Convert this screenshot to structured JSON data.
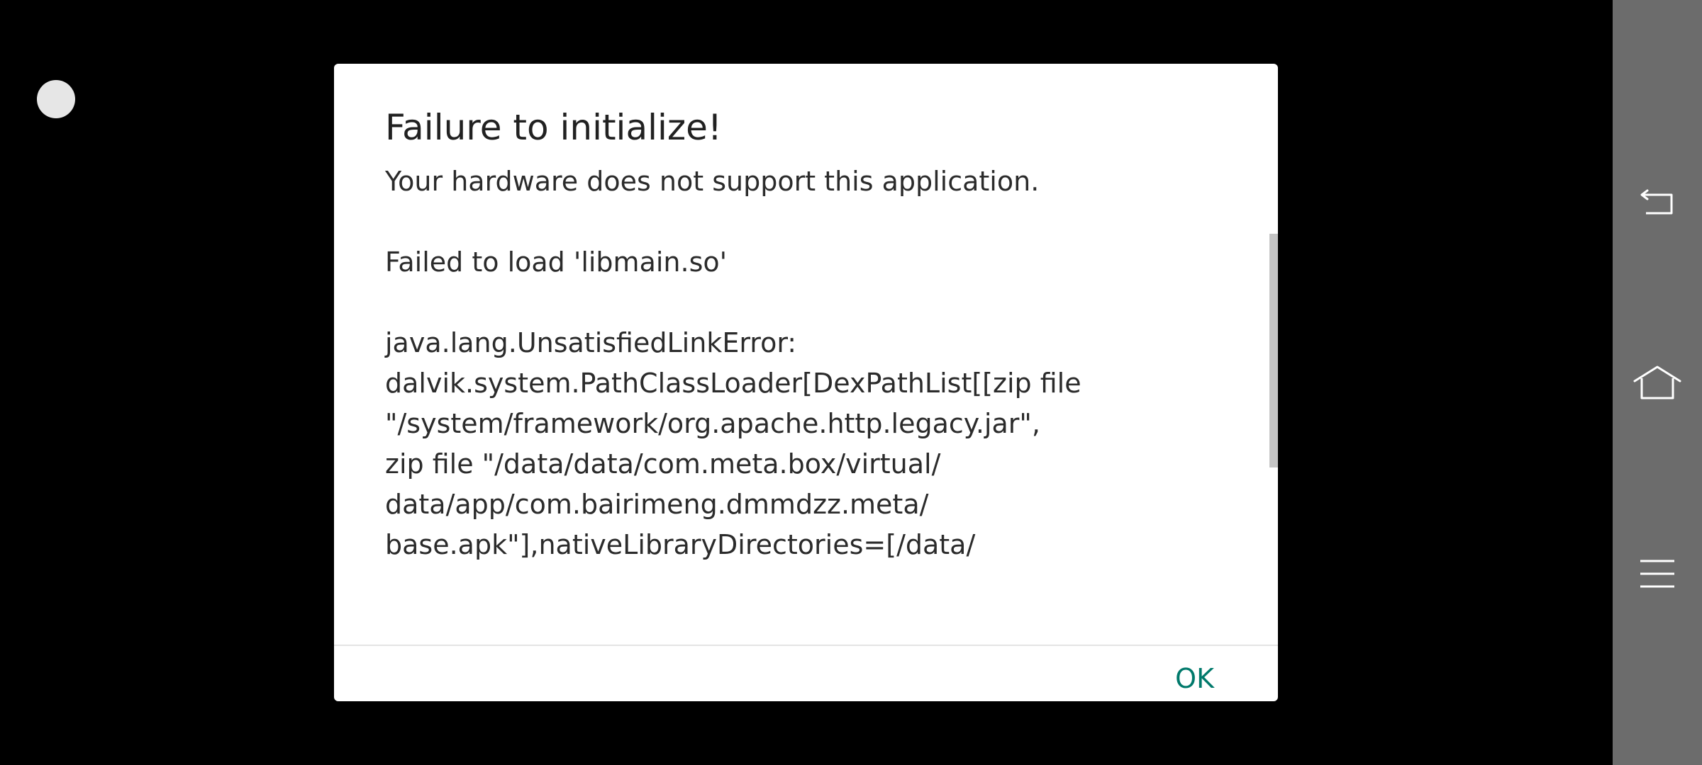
{
  "dialog": {
    "title": "Failure to initialize!",
    "message": "Your hardware does not support this application.\n\nFailed to load 'libmain.so'\n\njava.lang.UnsatisfiedLinkError:\ndalvik.system.PathClassLoader[DexPathList[[zip file\n\"/system/framework/org.apache.http.legacy.jar\",\nzip file \"/data/data/com.meta.box/virtual/\ndata/app/com.bairimeng.dmmdzz.meta/\nbase.apk\"],nativeLibraryDirectories=[/data/",
    "ok_label": "OK"
  },
  "nav_bar": {
    "buttons": [
      {
        "icon": "back-icon"
      },
      {
        "icon": "home-icon"
      },
      {
        "icon": "menu-icon"
      }
    ]
  },
  "colors": {
    "background": "#000000",
    "dialog_background": "#ffffff",
    "accent": "#00796b",
    "nav_bar": "#6c6c6c"
  }
}
